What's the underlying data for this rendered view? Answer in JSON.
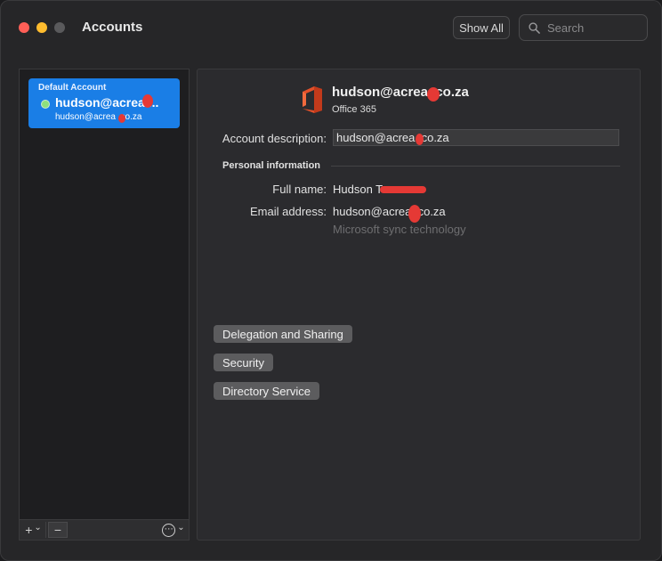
{
  "window": {
    "title": "Accounts",
    "show_all": "Show All",
    "search_placeholder": "Search"
  },
  "sidebar": {
    "account": {
      "default_label": "Default Account",
      "name": "hudson@acrea....",
      "email": "hudson@acrea .co.za",
      "status_color": "#8ee07d",
      "selected_color": "#1a7ee6"
    },
    "footer": {
      "add": "+",
      "add_chevron": "⌄",
      "remove": "−",
      "more": "⋯",
      "more_chevron": "⌄"
    }
  },
  "detail": {
    "header_email": "hudson@acrea .co.za",
    "account_type": "Office 365",
    "account_description_label": "Account description:",
    "account_description_value": "hudson@acrea .co.za",
    "personal_info_title": "Personal information",
    "full_name_label": "Full name:",
    "full_name_value": "Hudson T",
    "email_label": "Email address:",
    "email_value": "hudson@acrea .co.za",
    "sync_note": "Microsoft sync technology",
    "buttons": {
      "delegation": "Delegation and Sharing",
      "security": "Security",
      "directory": "Directory Service"
    }
  },
  "colors": {
    "close": "#ff5f57",
    "minimize": "#febc2e",
    "redaction": "#e53935"
  }
}
